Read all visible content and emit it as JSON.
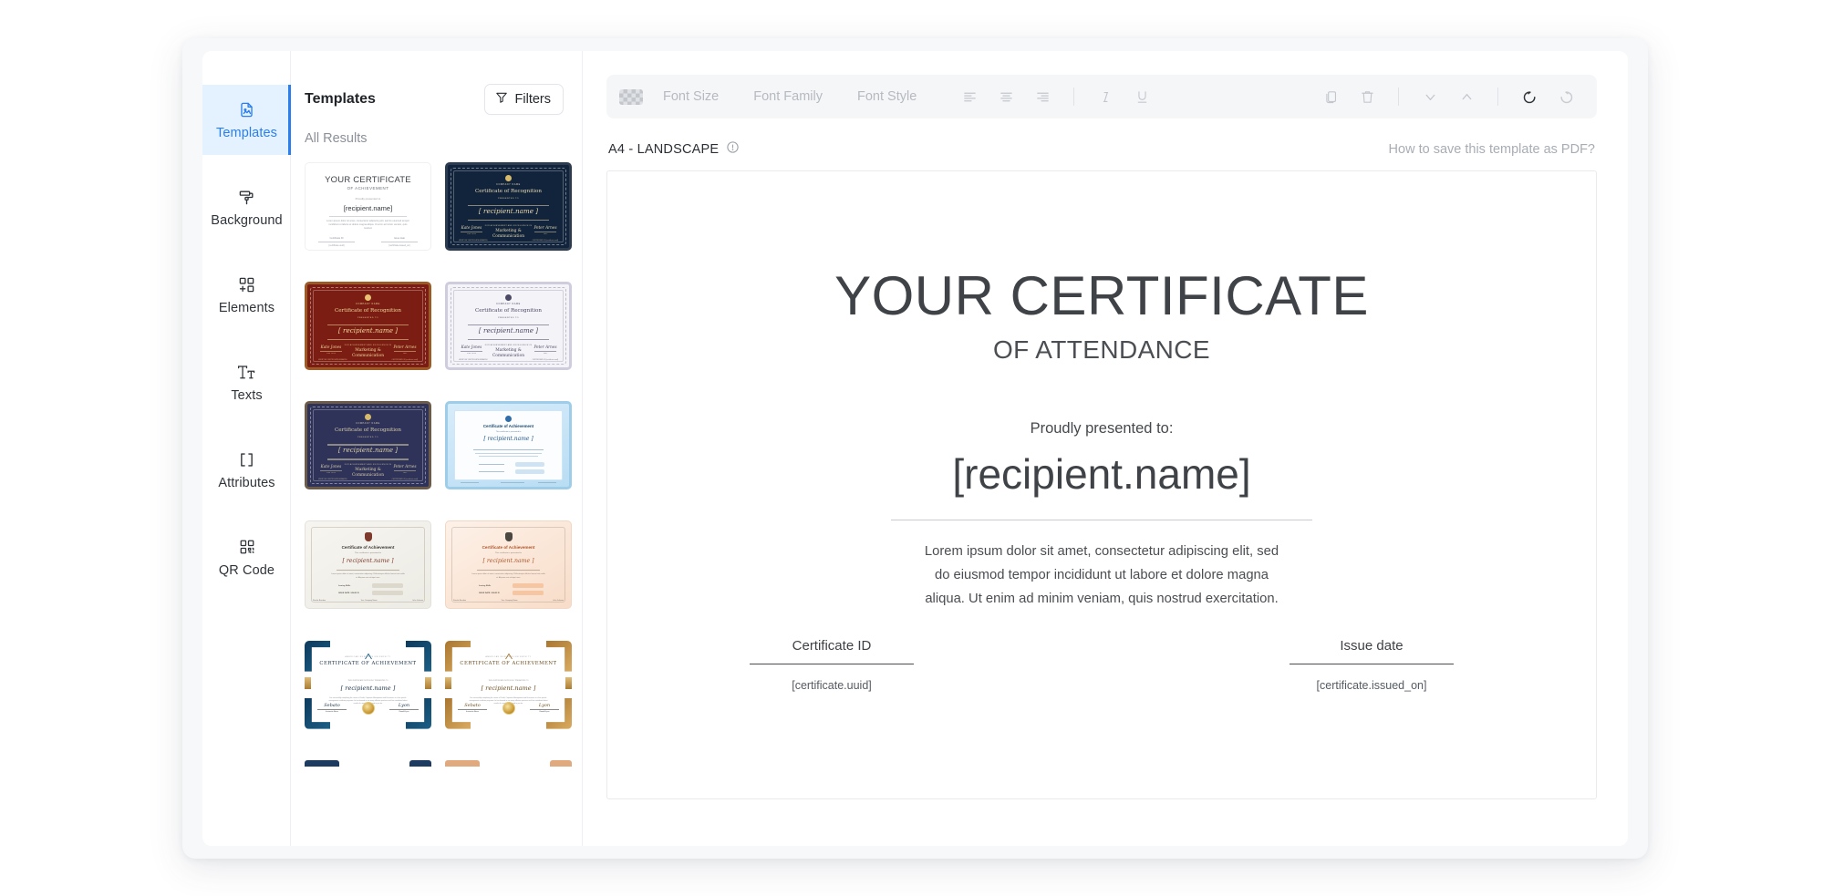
{
  "sidebar": {
    "items": [
      {
        "label": "Templates",
        "icon": "document-image-icon",
        "active": true
      },
      {
        "label": "Background",
        "icon": "paint-roller-icon",
        "active": false
      },
      {
        "label": "Elements",
        "icon": "add-element-icon",
        "active": false
      },
      {
        "label": "Texts",
        "icon": "text-size-icon",
        "active": false
      },
      {
        "label": "Attributes",
        "icon": "brackets-icon",
        "active": false
      },
      {
        "label": "QR Code",
        "icon": "qr-code-icon",
        "active": false
      }
    ],
    "accent_color": "#2a7fec",
    "active_bg_color": "#e4f1ff"
  },
  "templates_panel": {
    "title": "Templates",
    "filters_label": "Filters",
    "filters_icon": "funnel-icon",
    "results_label": "All Results",
    "thumbnails": [
      {
        "name": "plain-white-achievement",
        "style": "white",
        "title": "YOUR CERTIFICATE",
        "subtitle": "OF ACHIEVEMENT",
        "presented": "Proudly presented to",
        "recipient": "[recipient.name]",
        "body": "Lorem ipsum dolor sit amet, consectetur adipiscing elit, sed do eiusmod tempor incididunt ut labore et dolore magna aliqua. Ut enim ad minim veniam, quis nostrud.",
        "field1_label": "Certificate ID",
        "field1_value": "[certificate.uuid]",
        "field2_label": "Issue date",
        "field2_value": "[certificate.issued_on]"
      },
      {
        "name": "navy-recognition",
        "style": "ornate-navy",
        "company": "COMPANY NAME",
        "title": "Certificate of Recognition",
        "presented": "PRESENTED TO",
        "recipient": "[ recipient.name ]",
        "sig_left": "Kate Jones",
        "sig_left_sub": "JOB TITLE",
        "center_caption": "FOR ACHIEVEMENT AND EXCELLENCE IN",
        "center_text": "Marketing & Communication",
        "sig_right": "Peter Arnes",
        "sig_right_sub": "CEO",
        "foot_left": "VERIFY AT CERTIFICATE.EXAMPLE",
        "foot_right": "CERTIFICATE ID [certificate.uuid]"
      },
      {
        "name": "maroon-recognition",
        "style": "ornate-maroon",
        "company": "COMPANY NAME",
        "title": "Certificate of Recognition",
        "presented": "PRESENTED TO",
        "recipient": "[ recipient.name ]",
        "sig_left": "Kate Jones",
        "sig_left_sub": "JOB TITLE",
        "center_caption": "FOR ACHIEVEMENT AND EXCELLENCE IN",
        "center_text": "Marketing & Communication",
        "sig_right": "Peter Arnes",
        "sig_right_sub": "CEO",
        "foot_left": "VERIFY AT CERTIFICATE.EXAMPLE",
        "foot_right": "CERTIFICATE ID [certificate.uuid]"
      },
      {
        "name": "light-grey-recognition",
        "style": "ornate-light",
        "company": "COMPANY NAME",
        "title": "Certificate of Recognition",
        "presented": "PRESENTED TO",
        "recipient": "[ recipient.name ]",
        "sig_left": "Kate Jones",
        "sig_left_sub": "JOB TITLE",
        "center_caption": "FOR ACHIEVEMENT AND EXCELLENCE IN",
        "center_text": "Marketing & Communication",
        "sig_right": "Peter Arnes",
        "sig_right_sub": "CEO",
        "foot_left": "VERIFY AT CERTIFICATE.EXAMPLE",
        "foot_right": "CERTIFICATE ID [certificate.uuid]"
      },
      {
        "name": "dark-blue-recognition",
        "style": "ornate-darkblue",
        "company": "COMPANY NAME",
        "title": "Certificate of Recognition",
        "presented": "PRESENTED TO",
        "recipient": "[ recipient.name ]",
        "sig_left": "Kate Jones",
        "sig_left_sub": "JOB TITLE",
        "center_caption": "FOR ACHIEVEMENT AND EXCELLENCE IN",
        "center_text": "Marketing & Communication",
        "sig_right": "Peter Arnes",
        "sig_right_sub": "CEO",
        "foot_left": "VERIFY AT CERTIFICATE.EXAMPLE",
        "foot_right": "CERTIFICATE ID [certificate.uuid]"
      },
      {
        "name": "light-blue-achievement",
        "style": "blue-gradient",
        "title": "Certificate of Achievement",
        "presented": "This certificate is presented to",
        "recipient": "[ recipient.name ]"
      },
      {
        "name": "cream-achievement",
        "style": "cream",
        "title": "Certificate of Achievement",
        "presented": "This certificate is presented to",
        "recipient": "[ recipient.name ]",
        "row1_label": "Issuing Skills",
        "row2_label": "ISSUE DATE / VALID ID",
        "foot_left": "Rosalie Brandon",
        "foot_left_sub": "Director",
        "foot_center": "Your Company Name",
        "foot_right": "John Johnson",
        "foot_right_sub": "Manager"
      },
      {
        "name": "peach-achievement",
        "style": "peach",
        "title": "Certificate of Achievement",
        "presented": "This certificate is presented to",
        "recipient": "[ recipient.name ]",
        "row1_label": "Issuing Skills",
        "row2_label": "ISSUE DATE / VALID ID",
        "foot_left": "Rosalie Brandon",
        "foot_left_sub": "Director",
        "foot_center": "Your Company Name",
        "foot_right": "John Johnson",
        "foot_right_sub": "Manager"
      },
      {
        "name": "navy-gold-corner-achievement",
        "style": "corner-navy",
        "org": "AMERICAN BUSINESS UNIVERSITY",
        "title": "CERTIFICATE OF ACHIEVEMENT",
        "presented": "THIS CERTIFICATE IS PROUDLY PRESENTED TO",
        "recipient": "[ recipient.name ]",
        "body": "For successfully completing the course of Credit, Corporate Management and Economics in a few specific management certificate programs, he has learned to use many effective practices and has contributed about results of a stock and beyond to you do.",
        "sig_left": "Sebato",
        "sig_left_role": "Instructor Name",
        "sig_left_sub": "Certificate Trainer",
        "sig_right": "Lyon",
        "sig_right_role": "Donald Lyon",
        "sig_right_sub": "Director of the Board"
      },
      {
        "name": "gold-corner-achievement",
        "style": "corner-gold",
        "org": "AMERICAN BUSINESS UNIVERSITY",
        "title": "CERTIFICATE OF ACHIEVEMENT",
        "presented": "THIS CERTIFICATE IS PROUDLY PRESENTED TO",
        "recipient": "[ recipient.name ]",
        "body": "For successfully completing the course of Credit, Corporate Management and Economics in a few specific management certificate programs, he has learned to use many effective practices and has contributed about results of a stock and beyond to you do.",
        "sig_left": "Sebato",
        "sig_left_role": "Instructor Name",
        "sig_left_sub": "Certificate Trainer",
        "sig_right": "Lyon",
        "sig_right_role": "Donald Lyon",
        "sig_right_sub": "Director of the Board"
      }
    ]
  },
  "toolbar": {
    "color_swatch_name": "text-color-swatch",
    "font_size_label": "Font Size",
    "font_family_label": "Font Family",
    "font_style_label": "Font Style",
    "icons": [
      {
        "name": "align-left-icon"
      },
      {
        "name": "align-center-icon"
      },
      {
        "name": "align-right-icon"
      },
      {
        "name": "italic-icon"
      },
      {
        "name": "underline-icon"
      },
      {
        "name": "duplicate-icon"
      },
      {
        "name": "delete-icon"
      },
      {
        "name": "move-down-icon"
      },
      {
        "name": "move-up-icon"
      },
      {
        "name": "undo-icon"
      },
      {
        "name": "redo-icon"
      }
    ]
  },
  "canvas_meta": {
    "size_label": "A4 - LANDSCAPE",
    "info_icon": "info-icon",
    "pdf_link": "How to save this template as PDF?"
  },
  "certificate": {
    "title": "YOUR CERTIFICATE",
    "subtitle": "OF ATTENDANCE",
    "presented_to": "Proudly presented to:",
    "recipient": "[recipient.name]",
    "body": "Lorem ipsum dolor sit amet, consectetur adipiscing elit, sed do eiusmod tempor incididunt ut labore et dolore magna aliqua. Ut enim ad minim veniam, quis nostrud exercitation.",
    "field_id_label": "Certificate ID",
    "field_id_value": "[certificate.uuid]",
    "field_date_label": "Issue date",
    "field_date_value": "[certificate.issued_on]"
  }
}
